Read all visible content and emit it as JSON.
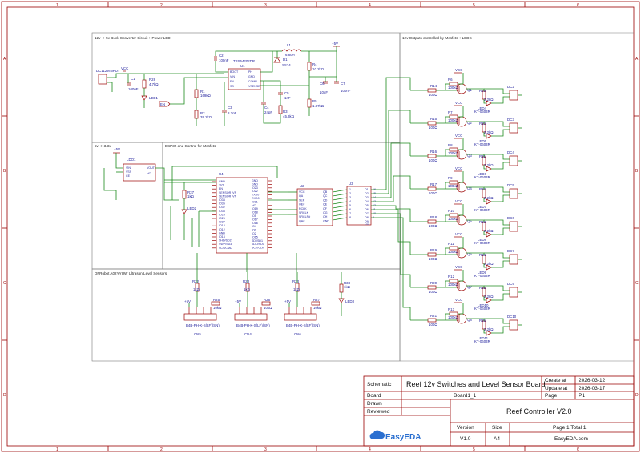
{
  "sheet": {
    "ruler_columns": [
      "1",
      "2",
      "3",
      "4",
      "5",
      "6"
    ],
    "ruler_rows": [
      "A",
      "B",
      "C",
      "D"
    ]
  },
  "sections": {
    "buck": "12v -> 5v Buck Converter Circuit + Power LED",
    "outputs": "12v Outputs controlled by Mosfets + LEDS",
    "ldo": "5v -> 3.3v",
    "esp": "ESP32 and Control for Mosfets",
    "sensors": "DFRobot A02YYUW Ultrason Level Sensors"
  },
  "buck": {
    "ic_name": "TPS54202DR",
    "ic_ref": "U1",
    "pins_left": [
      "BOOT",
      "VIN",
      "EN",
      "SS"
    ],
    "pins_right": [
      "PH",
      "GND",
      "COMP",
      "VSENSE"
    ],
    "input_connector": "DC112VINPUT",
    "vcc": "VCC",
    "v5": "+5V",
    "c2": "C2",
    "c2v": "100nF",
    "l1": "L1",
    "l1v": "6.8uH",
    "d1": "D1",
    "d1v": "SS24",
    "r4": "R4",
    "r4v": "10.2kΩ",
    "c6": "C6",
    "c6v": "10uF",
    "c7": "C7",
    "c7v": "100nF",
    "r5": "R5",
    "r5v": "1.87kΩ",
    "c1": "C1",
    "c1v": "100uF",
    "r28": "R28",
    "r28v": "4.7kΩ",
    "led1": "LED1",
    "r1": "R1",
    "r1v": "169kΩ",
    "r2": "R2",
    "r2v": "39.2kΩ",
    "c3": "C3",
    "c3v": "8.2nF",
    "c4": "C4",
    "c4v": "24pF",
    "c5": "C5",
    "c5v": "1nF",
    "r3": "R3",
    "r3v": "45.3kΩ",
    "en": "EN"
  },
  "ldo": {
    "name": "LDO1",
    "pins_left": [
      "VIN",
      "VSS",
      "CE"
    ],
    "pins_right": [
      "VOUT",
      "NC"
    ],
    "v5": "+5V"
  },
  "esp": {
    "ref": "U4",
    "pins_left": [
      "GND",
      "3V3",
      "EN",
      "SENSOR_VP",
      "SENSOR_VN",
      "IO34",
      "IO35",
      "IO32",
      "IO33",
      "IO25",
      "IO26",
      "IO27",
      "IO14",
      "IO12",
      "GND",
      "IO13",
      "SHD/SD2",
      "SWP/SD3",
      "SCS/CMD"
    ],
    "pins_right": [
      "GND",
      "GND",
      "IO23",
      "IO22",
      "TXD0",
      "RXD0",
      "IO21",
      "NC",
      "IO19",
      "IO18",
      "IO5",
      "IO17",
      "IO16",
      "IO4",
      "IO0",
      "IO2",
      "IO15",
      "SDI/SD1",
      "SDO/SD0",
      "SCK/CLK"
    ],
    "r37": "R37",
    "r37v": "1kΩ",
    "led2": "LED2"
  },
  "shift_register": {
    "ref": "U2",
    "pins_left": [
      "VCC",
      "QA",
      "SER",
      "OE#",
      "RCLK",
      "SRCLK",
      "SRCLR#",
      "QH#"
    ],
    "pins_right": [
      "QB",
      "QC",
      "QD",
      "QE",
      "QF",
      "QG",
      "QH",
      "GND"
    ]
  },
  "driver": {
    "ref": "U3",
    "pins_left": [
      "I1",
      "I2",
      "I3",
      "I4",
      "I5",
      "I6",
      "I7",
      "I8"
    ],
    "pins_right": [
      "O1",
      "O2",
      "O3",
      "O4",
      "O5",
      "O6",
      "O7",
      "O8",
      "O9"
    ],
    "pins_far_right": [
      "16",
      "15",
      "14",
      "13",
      "12",
      "11",
      "10",
      "9"
    ],
    "com": "CO"
  },
  "sensors": {
    "channels": [
      {
        "conn": "CN5",
        "part": "B4B-PH-K-S(LF)(SN)",
        "r_series": "R22",
        "r_series_v": "1kΩ",
        "r_pull": "R25",
        "r_pull_v": "10kΩ",
        "v5": "+5V"
      },
      {
        "conn": "CN4",
        "part": "B4B-PH-K-S(LF)(SN)",
        "r_series": "R23",
        "r_series_v": "1kΩ",
        "r_pull": "R26",
        "r_pull_v": "10kΩ",
        "v5": "+5V"
      },
      {
        "conn": "CN6",
        "part": "B4B-PH-K-S(LF)(SN)",
        "r_series": "R24",
        "r_series_v": "1kΩ",
        "r_pull": "R27",
        "r_pull_v": "10kΩ",
        "v5": "+5V"
      }
    ],
    "r38": "R38",
    "r38v": "1kΩ",
    "led3": "LED3"
  },
  "outputs": [
    {
      "r_gate": "R14",
      "r_gate_v": "100Ω",
      "r_pd": "R6",
      "r_pd_v": "100kΩ",
      "q": "Q1",
      "r_led": "R29",
      "r_led_v": "2.2kΩ",
      "led": "LED4",
      "led_part": "KT-0603R",
      "conn": "DC2",
      "vcc": "VCC"
    },
    {
      "r_gate": "R15",
      "r_gate_v": "100Ω",
      "r_pd": "R7",
      "r_pd_v": "100kΩ",
      "q": "Q2",
      "r_led": "R30",
      "r_led_v": "2.2kΩ",
      "led": "LED5",
      "led_part": "KT-0603R",
      "conn": "DC3",
      "vcc": "VCC"
    },
    {
      "r_gate": "R16",
      "r_gate_v": "100Ω",
      "r_pd": "R8",
      "r_pd_v": "100kΩ",
      "q": "Q3",
      "r_led": "R31",
      "r_led_v": "2.2kΩ",
      "led": "LED6",
      "led_part": "KT-0603R",
      "conn": "DC4",
      "vcc": "VCC"
    },
    {
      "r_gate": "R17",
      "r_gate_v": "100Ω",
      "r_pd": "R9",
      "r_pd_v": "100kΩ",
      "q": "Q4",
      "r_led": "R32",
      "r_led_v": "2.2kΩ",
      "led": "LED7",
      "led_part": "KT-0603R",
      "conn": "DC5",
      "vcc": "VCC"
    },
    {
      "r_gate": "R18",
      "r_gate_v": "100Ω",
      "r_pd": "R10",
      "r_pd_v": "100kΩ",
      "q": "Q5",
      "r_led": "R33",
      "r_led_v": "2.2kΩ",
      "led": "LED8",
      "led_part": "KT-0603R",
      "conn": "DC6",
      "vcc": "VCC"
    },
    {
      "r_gate": "R19",
      "r_gate_v": "100Ω",
      "r_pd": "R11",
      "r_pd_v": "100kΩ",
      "q": "Q6",
      "r_led": "R34",
      "r_led_v": "2.2kΩ",
      "led": "LED9",
      "led_part": "KT-0603R",
      "conn": "DC7",
      "vcc": "VCC"
    },
    {
      "r_gate": "R20",
      "r_gate_v": "100Ω",
      "r_pd": "R12",
      "r_pd_v": "100kΩ",
      "q": "Q7",
      "r_led": "R35",
      "r_led_v": "2.2kΩ",
      "led": "LED10",
      "led_part": "KT-0603R",
      "conn": "DC9",
      "vcc": "VCC"
    },
    {
      "r_gate": "R21",
      "r_gate_v": "100Ω",
      "r_pd": "R13",
      "r_pd_v": "100kΩ",
      "q": "Q8",
      "r_led": "R36",
      "r_led_v": "2.2kΩ",
      "led": "LED11",
      "led_part": "KT-0603R",
      "conn": "DC10",
      "vcc": "VCC"
    }
  ],
  "title_block": {
    "schematic_label": "Schematic",
    "title": "Reef 12v Switches and Level Sensor Board",
    "create_label": "Create at",
    "create_date": "2026-03-12",
    "update_label": "Update at",
    "update_date": "2026-03-17",
    "board_label": "Board",
    "board_value": "Board1_1",
    "page_label": "Page",
    "page_value": "P1",
    "drawn_label": "Drawn",
    "reviewed_label": "Reviewed",
    "project": "Reef Controller V2.0",
    "version_label": "Version",
    "version_value": "V1.0",
    "size_label": "Size",
    "size_value": "A4",
    "page_total": "Page   1  Total   1",
    "logo_text": "EasyEDA",
    "site": "EasyEDA.com"
  }
}
